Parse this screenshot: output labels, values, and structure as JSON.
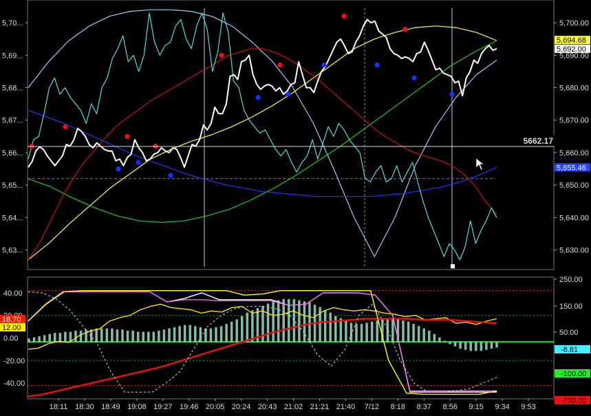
{
  "chart_data": [
    {
      "type": "line",
      "panel": "price",
      "title": "",
      "right_axis": {
        "ticks": [
          "5,700.00",
          "5,690.00",
          "5,680.00",
          "5,670.00",
          "5,660.00",
          "5,650.00",
          "5,640.00",
          "5,630.00"
        ],
        "tick_values": [
          5700,
          5690,
          5680,
          5670,
          5660,
          5650,
          5640,
          5630
        ]
      },
      "left_axis": {
        "ticks": [
          "5,70...",
          "5,69...",
          "5,68...",
          "5,67...",
          "5,66...",
          "5,65...",
          "5,64...",
          "5,63..."
        ],
        "tick_values": [
          5700,
          5690,
          5680,
          5670,
          5660,
          5650,
          5640,
          5630
        ]
      },
      "ylim": [
        5624,
        5707
      ],
      "value_tags": [
        {
          "label": "5,694.68",
          "value": 5694.68,
          "bg": "#ffff33",
          "fg": "#000000"
        },
        {
          "label": "5,692.00",
          "value": 5692.0,
          "bg": "#ffffff",
          "fg": "#000000"
        },
        {
          "label": "5,655.46",
          "value": 5655.46,
          "bg": "#2244ff",
          "fg": "#ffffff"
        }
      ],
      "crosshair_value": "5662.17",
      "crosshair": {
        "value": 5662.17
      },
      "reference_line": {
        "value": 5652.0,
        "color": "#cc44cc"
      },
      "series": [
        {
          "name": "",
          "color": "#ffffff",
          "values": [
            5655.5,
            5657.2,
            5660.5,
            5661.8,
            5661.0,
            5659.0,
            5657.5,
            5656.0,
            5657.5,
            5659.0,
            5662.5,
            5662.0,
            5664.0,
            5667.5,
            5666.5,
            5665.0,
            5662.5,
            5661.5,
            5663.0,
            5662.0,
            5661.0,
            5660.5,
            5660.5,
            5657.5,
            5658.0,
            5656.0,
            5658.5,
            5659.5,
            5664.0,
            5661.5,
            5660.0,
            5657.5,
            5658.0,
            5659.5,
            5660.0,
            5661.5,
            5660.5,
            5660.0,
            5661.5,
            5661.0,
            5658.5,
            5655.5,
            5659.0,
            5662.5,
            5662.0,
            5664.0,
            5668.5,
            5667.0,
            5669.0,
            5674.0,
            5672.0,
            5672.0,
            5675.0,
            5683.5,
            5684.0,
            5682.5,
            5688.0,
            5688.5,
            5690.0,
            5684.0,
            5681.0,
            5679.5,
            5680.5,
            5681.0,
            5680.5,
            5679.0,
            5680.0,
            5678.0,
            5679.0,
            5681.0,
            5681.5,
            5688.0,
            5684.0,
            5680.0,
            5680.0,
            5678.5,
            5682.0,
            5685.0,
            5686.5,
            5689.0,
            5691.5,
            5694.0,
            5695.0,
            5693.0,
            5690.5,
            5691.0,
            5694.0,
            5696.0,
            5699.0,
            5701.0,
            5700.0,
            5700.5,
            5697.5,
            5696.5,
            5695.5,
            5692.0,
            5690.5,
            5690.0,
            5689.0,
            5689.5,
            5689.0,
            5688.0,
            5690.5,
            5691.0,
            5694.0,
            5691.5,
            5688.5,
            5685.5,
            5686.0,
            5684.5,
            5684.0,
            5683.5,
            5681.5,
            5682.0,
            5677.5,
            5683.0,
            5685.0,
            5688.5,
            5687.5,
            5690.5,
            5692.0,
            5693.0,
            5691.5,
            5692.0
          ]
        },
        {
          "name": "",
          "color": "#55dddd",
          "values": [
            5658.0,
            5664.0,
            5665.0,
            5672.0,
            5680.0,
            5683.0,
            5678.0,
            5680.0,
            5677.0,
            5675.0,
            5673.0,
            5669.0,
            5675.0,
            5672.0,
            5680.0,
            5683.0,
            5689.0,
            5692.0,
            5696.0,
            5688.0,
            5690.0,
            5685.0,
            5690.0,
            5703.0,
            5694.0,
            5690.0,
            5693.0,
            5694.0,
            5699.0,
            5701.0,
            5695.0,
            5692.0,
            5699.0,
            5703.0,
            5698.0,
            5685.0,
            5691.0,
            5703.0,
            5697.0,
            5682.0,
            5680.0,
            5673.0,
            5670.0,
            5668.0,
            5666.0,
            5667.0,
            5664.0,
            5661.0,
            5659.0,
            5661.0,
            5657.0,
            5654.0,
            5657.0,
            5659.0,
            5664.0,
            5658.0,
            5663.0,
            5668.0,
            5665.0,
            5669.0,
            5667.0,
            5664.0,
            5662.0,
            5660.0,
            5652.0,
            5651.0,
            5654.0,
            5656.0,
            5651.0,
            5652.0,
            5656.0,
            5651.0,
            5654.0,
            5657.0,
            5651.0,
            5645.0,
            5640.0,
            5636.0,
            5632.0,
            5628.0,
            5632.0,
            5630.0,
            5627.0,
            5631.0,
            5639.0,
            5632.0,
            5636.0,
            5639.0,
            5643.0,
            5640.0
          ]
        },
        {
          "name": "",
          "color": "#cc1111",
          "values": [
            5627.0,
            5632.0,
            5639.0,
            5646.0,
            5652.0,
            5657.0,
            5661.0,
            5665.0,
            5668.5,
            5671.0,
            5673.5,
            5676.0,
            5678.0,
            5680.0,
            5682.0,
            5684.0,
            5686.0,
            5688.0,
            5690.0,
            5691.0,
            5692.0,
            5692.0,
            5691.0,
            5689.5,
            5687.5,
            5685.0,
            5682.5,
            5679.5,
            5676.5,
            5673.5,
            5670.5,
            5667.5,
            5665.0,
            5663.0,
            5661.0,
            5659.5,
            5658.5,
            5657.5,
            5656.0,
            5653.5,
            5650.0,
            5645.0,
            5641.0
          ]
        },
        {
          "name": "",
          "color": "#2233ff",
          "values": [
            5673.0,
            5671.0,
            5669.0,
            5666.5,
            5664.0,
            5661.5,
            5659.0,
            5657.0,
            5655.0,
            5653.0,
            5651.5,
            5650.0,
            5649.0,
            5648.0,
            5647.5,
            5647.0,
            5646.5,
            5646.5,
            5646.5,
            5646.5,
            5647.0,
            5647.5,
            5648.5,
            5649.5,
            5651.0,
            5653.0,
            5655.5
          ]
        },
        {
          "name": "",
          "color": "#22cc22",
          "values": [
            5652.0,
            5649.5,
            5646.0,
            5643.0,
            5640.5,
            5639.0,
            5638.5,
            5639.0,
            5640.5,
            5642.5,
            5645.5,
            5649.0,
            5653.0,
            5657.5,
            5662.0,
            5667.0,
            5672.0,
            5677.0,
            5682.0,
            5687.0,
            5691.0,
            5694.5
          ]
        },
        {
          "name": "",
          "color": "#ffff44",
          "values": [
            5627.0,
            5632.0,
            5638.0,
            5643.5,
            5649.0,
            5653.5,
            5658.0,
            5661.0,
            5663.5,
            5665.5,
            5668.0,
            5671.0,
            5674.5,
            5678.5,
            5683.0,
            5687.5,
            5692.0,
            5695.0,
            5697.0,
            5698.5,
            5699.0,
            5698.5,
            5697.0,
            5694.5
          ]
        },
        {
          "name": "",
          "color": "#99ccff",
          "values": [
            5680.0,
            5688.0,
            5694.5,
            5699.0,
            5702.0,
            5703.5,
            5704.0,
            5704.0,
            5703.5,
            5702.0,
            5699.0,
            5694.0,
            5688.0,
            5680.0,
            5669.0,
            5655.0,
            5640.0,
            5628.0,
            5640.0,
            5656.0,
            5668.0,
            5677.0,
            5684.0,
            5688.5
          ]
        }
      ],
      "markers": {
        "red": [
          [
            46,
            5662
          ],
          [
            95,
            5668
          ],
          [
            185,
            5665
          ],
          [
            226,
            5662
          ],
          [
            322,
            5690
          ],
          [
            407,
            5687
          ],
          [
            500,
            5702
          ],
          [
            589,
            5698
          ]
        ],
        "blue": [
          [
            172,
            5655
          ],
          [
            201,
            5657
          ],
          [
            248,
            5653
          ],
          [
            375,
            5677
          ],
          [
            419,
            5678
          ],
          [
            471,
            5687
          ],
          [
            548,
            5687
          ],
          [
            602,
            5683
          ],
          [
            657,
            5678
          ]
        ]
      },
      "low_marker": {
        "x": 658,
        "value": 5625
      }
    },
    {
      "type": "line",
      "panel": "oscillator",
      "left_axis": {
        "ticks": [
          "40.00",
          "20.00",
          "0.00",
          "-20.00",
          "-40.00"
        ],
        "tick_values": [
          40,
          20,
          0,
          -20,
          -40
        ]
      },
      "right_axis": {
        "ticks": [
          "250.00",
          "150.00",
          "50.00"
        ],
        "tick_values": [
          250,
          150,
          50
        ]
      },
      "left_tags": [
        {
          "label": "18.70",
          "bg": "#ee2200",
          "fg": "#ffffff"
        },
        {
          "label": "12.00",
          "bg": "#ffee00",
          "fg": "#000000"
        }
      ],
      "right_tags": [
        {
          "label": "-8.81",
          "bg": "#44eeff",
          "fg": "#000000"
        },
        {
          "label": "-100.00",
          "bg": "#22ee22",
          "fg": "#000000"
        },
        {
          "label": "-200.00",
          "bg": "#ee1111",
          "fg": "#000000"
        }
      ],
      "ylim": [
        -54,
        54
      ],
      "histogram_color": "#99ddcc",
      "histogram": [
        3,
        4,
        5,
        6,
        7,
        8,
        8,
        9,
        9,
        10,
        10,
        11,
        11,
        12,
        12,
        12,
        12,
        11,
        11,
        10,
        10,
        9,
        9,
        9,
        9,
        10,
        11,
        12,
        13,
        14,
        15,
        15,
        14,
        13,
        12,
        12,
        13,
        14,
        16,
        18,
        20,
        23,
        26,
        28,
        30,
        32,
        34,
        36,
        37,
        38,
        38,
        38,
        37,
        36,
        35,
        33,
        31,
        28,
        26,
        23,
        21,
        19,
        17,
        16,
        16,
        17,
        18,
        19,
        20,
        21,
        21,
        20,
        19,
        18,
        16,
        14,
        12,
        10,
        7,
        4,
        1,
        -2,
        -4,
        -6,
        -7,
        -8,
        -8,
        -8,
        -7,
        -6,
        -5
      ],
      "series": [
        {
          "name": "",
          "color": "#ffdd00",
          "values": [
            -10,
            -9,
            -5,
            -3,
            -4,
            2,
            6,
            8,
            15,
            18,
            20,
            25,
            28,
            30,
            27,
            26,
            25,
            22,
            24,
            23,
            27,
            28,
            22,
            24,
            20,
            21,
            24,
            20,
            18,
            24,
            27,
            25,
            24,
            25,
            24,
            22,
            21,
            19,
            20,
            16,
            17,
            18,
            13,
            14,
            12,
            15,
            17
          ]
        },
        {
          "name": "",
          "color": "#ee1111",
          "values": [
            -52,
            -50,
            -47,
            -44,
            -41,
            -38,
            -35,
            -32,
            -29,
            -26,
            -22,
            -18,
            -14,
            -10,
            -6,
            -2,
            2,
            6,
            9,
            12,
            14,
            15,
            16,
            17,
            17,
            17,
            17,
            16,
            16,
            16,
            15,
            14,
            13
          ]
        },
        {
          "name": "",
          "color": "#ffffff",
          "values": [
            15,
            30,
            41,
            41,
            41,
            41,
            41,
            41,
            32,
            35,
            40,
            34,
            34,
            34,
            34,
            29,
            30,
            40,
            40,
            40,
            38,
            20,
            -48,
            -48,
            -48,
            -48,
            -48,
            -48
          ]
        },
        {
          "name": "",
          "color": "#ee66ee",
          "values": [
            15,
            30,
            41,
            41,
            41,
            41,
            41,
            41,
            32,
            34,
            34,
            33,
            33,
            33,
            33,
            29,
            30,
            40,
            40,
            40,
            38,
            20,
            -47,
            -47,
            -47,
            -47,
            -47,
            -47
          ]
        },
        {
          "name": "",
          "color": "#ffff00",
          "values": [
            15,
            30,
            41,
            42,
            42,
            42,
            42,
            42,
            42,
            42,
            42,
            42,
            38,
            39,
            42,
            42,
            42,
            42,
            42,
            42,
            -20,
            -49,
            -50,
            -50,
            -50,
            -50,
            -47
          ]
        },
        {
          "name": "",
          "color": "#dddddd",
          "values": [
            41,
            40,
            35,
            25,
            10,
            -5,
            -30,
            -48,
            -48,
            -48,
            -40,
            -30,
            -10,
            10,
            20,
            26,
            28,
            28,
            26,
            20,
            5,
            -15,
            -25,
            -10,
            20,
            30,
            10,
            -20,
            -40,
            -48,
            -48,
            -47,
            -45,
            -40,
            -35
          ]
        }
      ]
    }
  ],
  "time_axis": {
    "labels": [
      "18:11",
      "18:30",
      "18:49",
      "19:08",
      "19:27",
      "19:46",
      "20:05",
      "20:24",
      "20:43",
      "21:02",
      "21:21",
      "21:40",
      "7/12",
      "8:18",
      "8:37",
      "8:56",
      "9:15",
      "9:34",
      "9:53"
    ]
  }
}
